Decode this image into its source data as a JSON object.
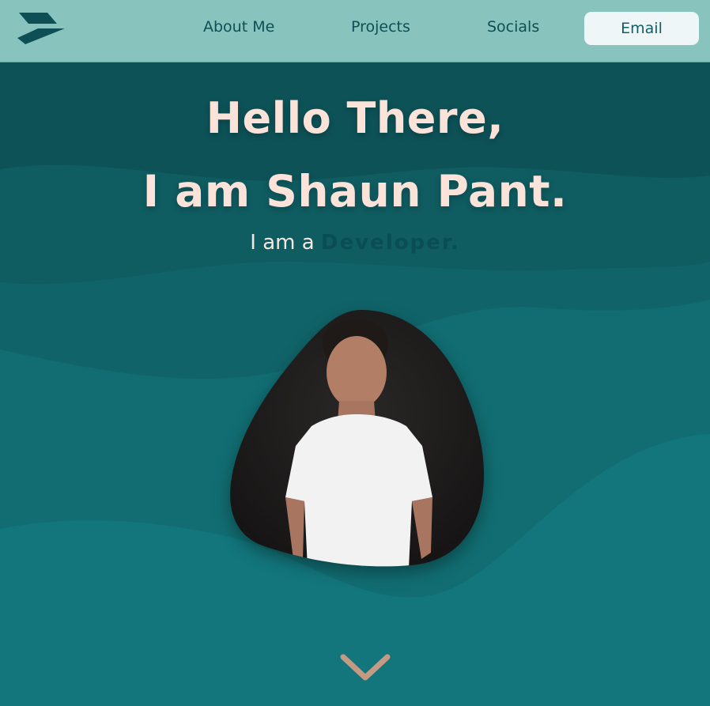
{
  "nav": {
    "logo_icon": "z-logo-icon",
    "links": [
      "About Me",
      "Projects",
      "Socials"
    ],
    "email_label": "Email"
  },
  "hero": {
    "greeting": "Hello There,",
    "intro": "I am Shaun Pant.",
    "role_prefix": "I am a",
    "role": "Developer.",
    "portrait_icon": "person-portrait",
    "scroll_icon": "chevron-down-icon"
  },
  "colors": {
    "nav_bg": "#88c4bd",
    "hero_dark": "#0d5257",
    "hero_light": "#127e85",
    "headline": "#fbe3da",
    "accent": "#0d4f55",
    "chevron": "#c59a84"
  }
}
